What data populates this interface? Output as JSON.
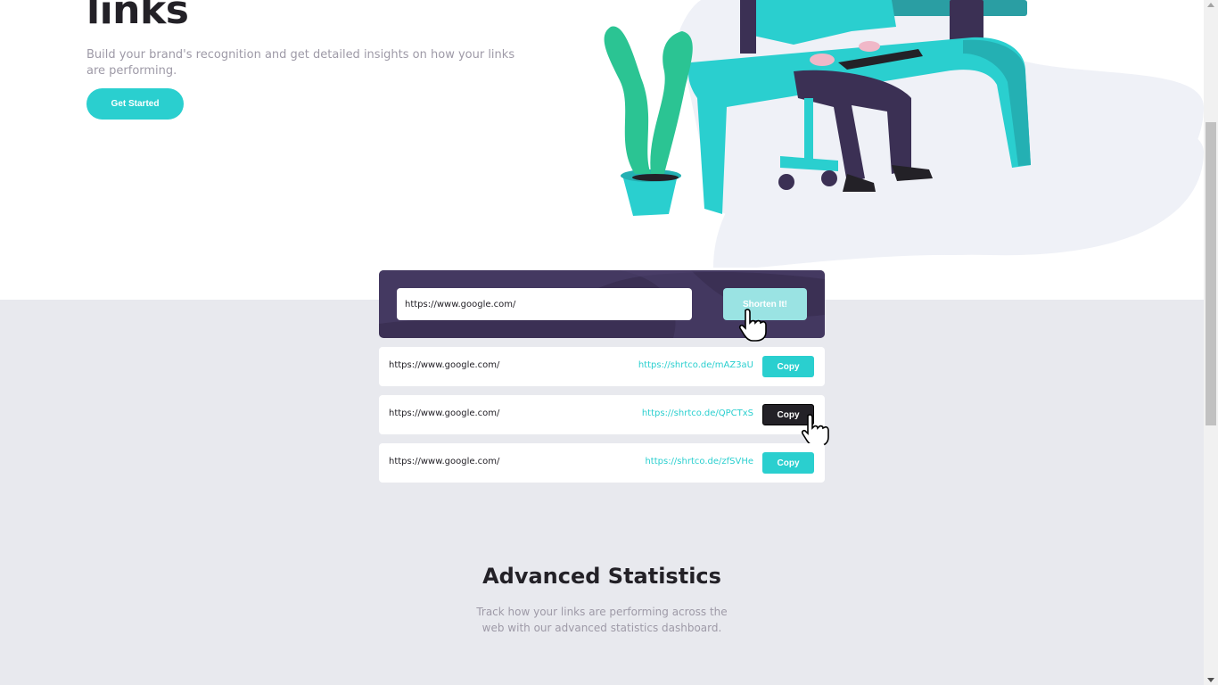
{
  "hero": {
    "title_partial": "links",
    "description": "Build your brand's recognition and get detailed insights on how your links are performing.",
    "cta_label": "Get Started"
  },
  "shortener": {
    "input_value": "https://www.google.com/",
    "button_label": "Shorten It!"
  },
  "results": [
    {
      "original": "https://www.google.com/",
      "short": "https://shrtco.de/mAZ3aU",
      "button": "Copy"
    },
    {
      "original": "https://www.google.com/",
      "short": "https://shrtco.de/QPCTxS",
      "button": "Copy"
    },
    {
      "original": "https://www.google.com/",
      "short": "https://shrtco.de/zfSVHe",
      "button": "Copy"
    }
  ],
  "stats": {
    "title": "Advanced Statistics",
    "description": "Track how your links are performing across the web with our advanced statistics dashboard."
  },
  "colors": {
    "primary": "#2acfcf",
    "primary_light": "#9ae3e3",
    "dark_violet": "#3b3054",
    "dark": "#232127",
    "gray_text": "#9e9aa7",
    "section_bg": "#e8e9ee"
  }
}
